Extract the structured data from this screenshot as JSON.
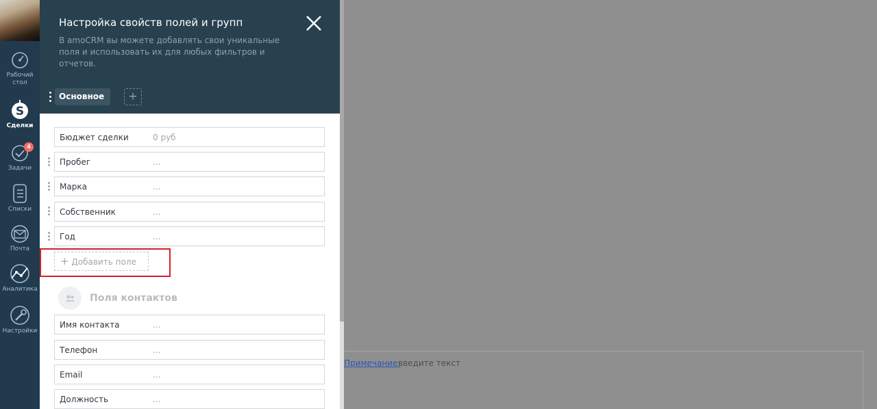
{
  "sidebar": {
    "items": [
      {
        "label": "Рабочий стол",
        "icon": "dashboard-icon"
      },
      {
        "label": "Сделки",
        "icon": "deals-icon",
        "active": true
      },
      {
        "label": "Задачи",
        "icon": "tasks-icon",
        "badge": "4"
      },
      {
        "label": "Списки",
        "icon": "lists-icon"
      },
      {
        "label": "Почта",
        "icon": "mail-icon"
      },
      {
        "label": "Аналитика",
        "icon": "analytics-icon"
      },
      {
        "label": "Настройки",
        "icon": "settings-icon"
      }
    ]
  },
  "panel": {
    "title": "Настройка свойств полей и групп",
    "description": "В amoCRM вы можете добавлять свои уникальные поля и использовать их для любых фильтров и отчетов.",
    "tabs": [
      {
        "label": "Основное"
      }
    ],
    "fields": [
      {
        "label": "Бюджет сделки",
        "value": "0 руб"
      },
      {
        "label": "Пробег",
        "value": "..."
      },
      {
        "label": "Марка",
        "value": "..."
      },
      {
        "label": "Собственник",
        "value": "..."
      },
      {
        "label": "Год",
        "value": "..."
      }
    ],
    "add_field_label": "Добавить поле",
    "contacts_title": "Поля контактов",
    "contact_fields": [
      {
        "label": "Имя контакта",
        "value": "..."
      },
      {
        "label": "Телефон",
        "value": "..."
      },
      {
        "label": "Email",
        "value": "..."
      },
      {
        "label": "Должность",
        "value": "..."
      }
    ]
  },
  "note": {
    "link": "Примечание",
    "colon": ":",
    "placeholder": "введите текст"
  },
  "colors": {
    "sidebar_bg": "#213a4e",
    "header_bg": "#27414f",
    "overlay_bg": "#8f8f8f",
    "highlight": "#d0202a",
    "badge": "#f56a6a"
  }
}
